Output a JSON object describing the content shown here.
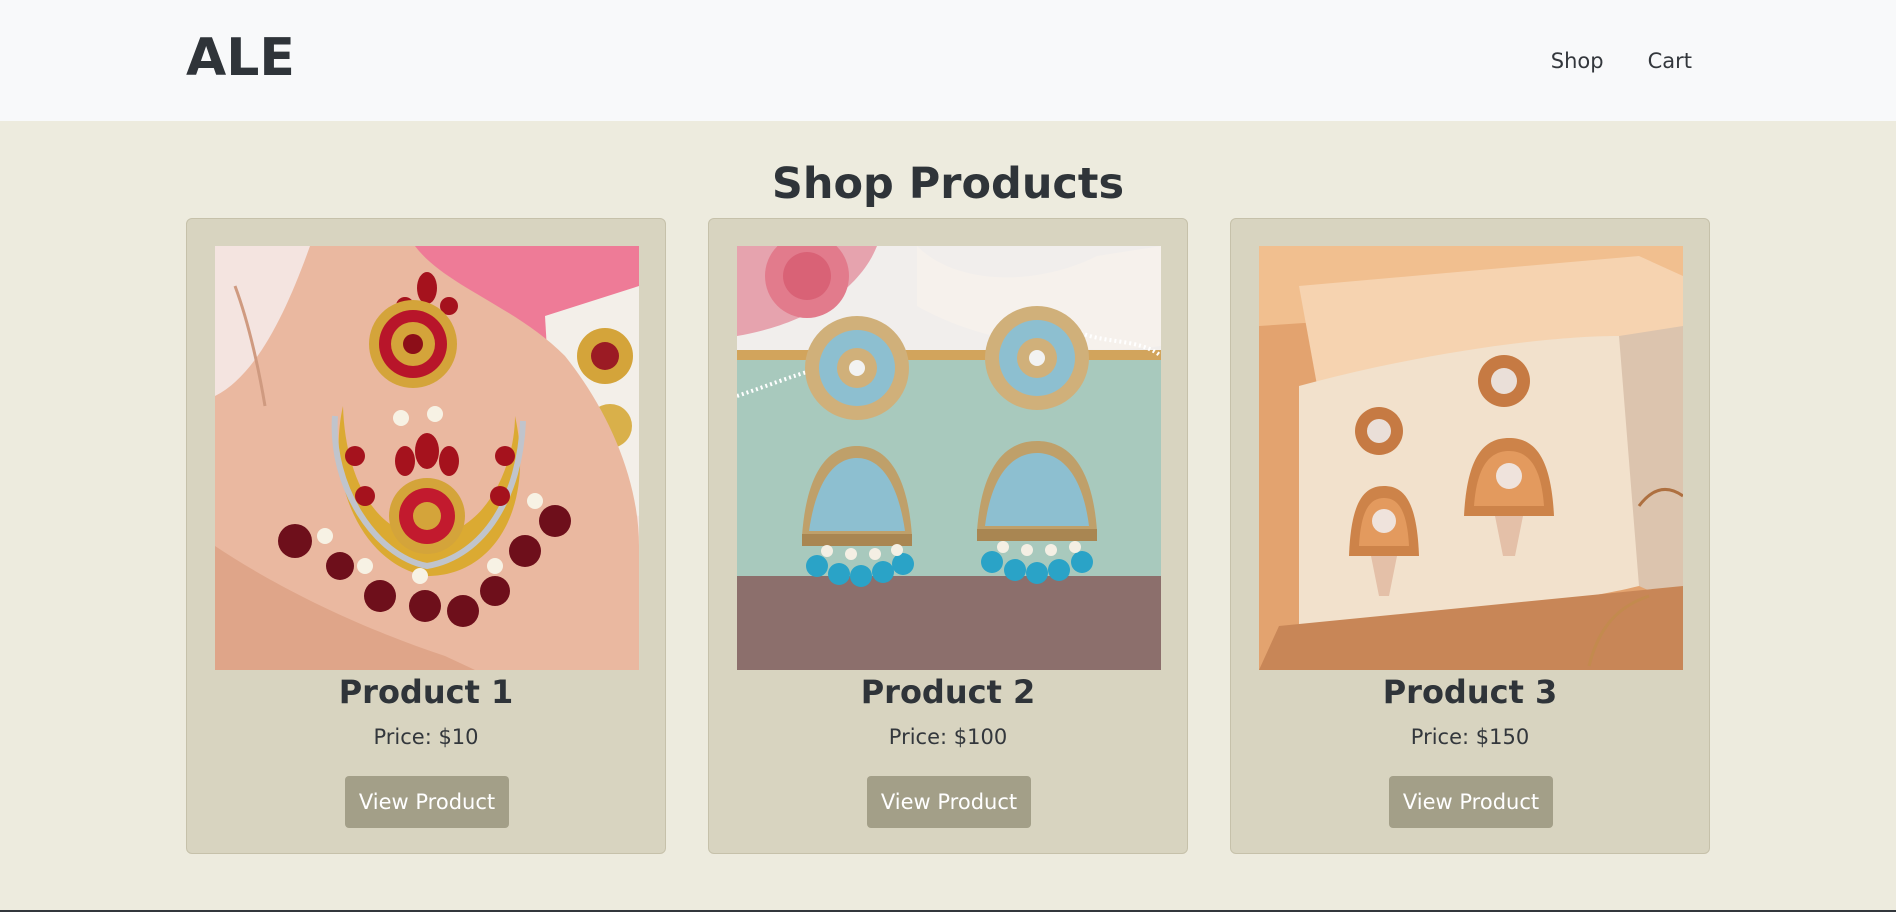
{
  "navbar": {
    "brand": "ALE",
    "links": [
      "Shop",
      "Cart"
    ]
  },
  "main": {
    "title": "Shop Products",
    "products": [
      {
        "name": "Product 1",
        "price": "Price: $10",
        "button": "View Product",
        "image": "red-gold-chandbali-earring-image"
      },
      {
        "name": "Product 2",
        "price": "Price: $100",
        "button": "View Product",
        "image": "turquoise-jhumka-earrings-image"
      },
      {
        "name": "Product 3",
        "price": "Price: $150",
        "button": "View Product",
        "image": "rose-gold-jhumka-earrings-image"
      }
    ]
  },
  "colors": {
    "navbar_bg": "#f8f9fa",
    "page_bg": "#edebde",
    "card_bg": "#d8d4c0",
    "button_bg": "#a39f88",
    "text": "#2f3439"
  }
}
